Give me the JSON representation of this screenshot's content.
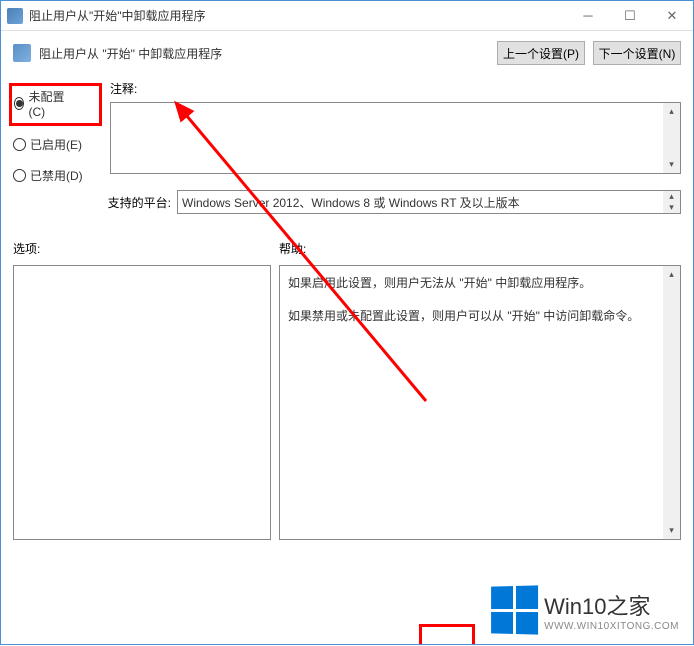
{
  "window": {
    "title": "阻止用户从\"开始\"中卸载应用程序"
  },
  "header": {
    "description": "阻止用户从 \"开始\" 中卸载应用程序",
    "prev_btn": "上一个设置(P)",
    "next_btn": "下一个设置(N)"
  },
  "radios": {
    "not_configured": "未配置(C)",
    "enabled": "已启用(E)",
    "disabled": "已禁用(D)",
    "selected": "not_configured"
  },
  "comment_label": "注释:",
  "platform": {
    "label": "支持的平台:",
    "value": "Windows Server 2012、Windows 8 或 Windows RT 及以上版本"
  },
  "sections": {
    "options": "选项:",
    "help": "帮助:"
  },
  "help_text": {
    "p1": "如果启用此设置，则用户无法从 \"开始\" 中卸载应用程序。",
    "p2": "如果禁用或未配置此设置，则用户可以从 \"开始\" 中访问卸载命令。"
  },
  "watermark": {
    "title": "Win10之家",
    "sub": "WWW.WIN10XITONG.COM"
  },
  "annotation": {
    "arrow_color": "#ff0000"
  }
}
